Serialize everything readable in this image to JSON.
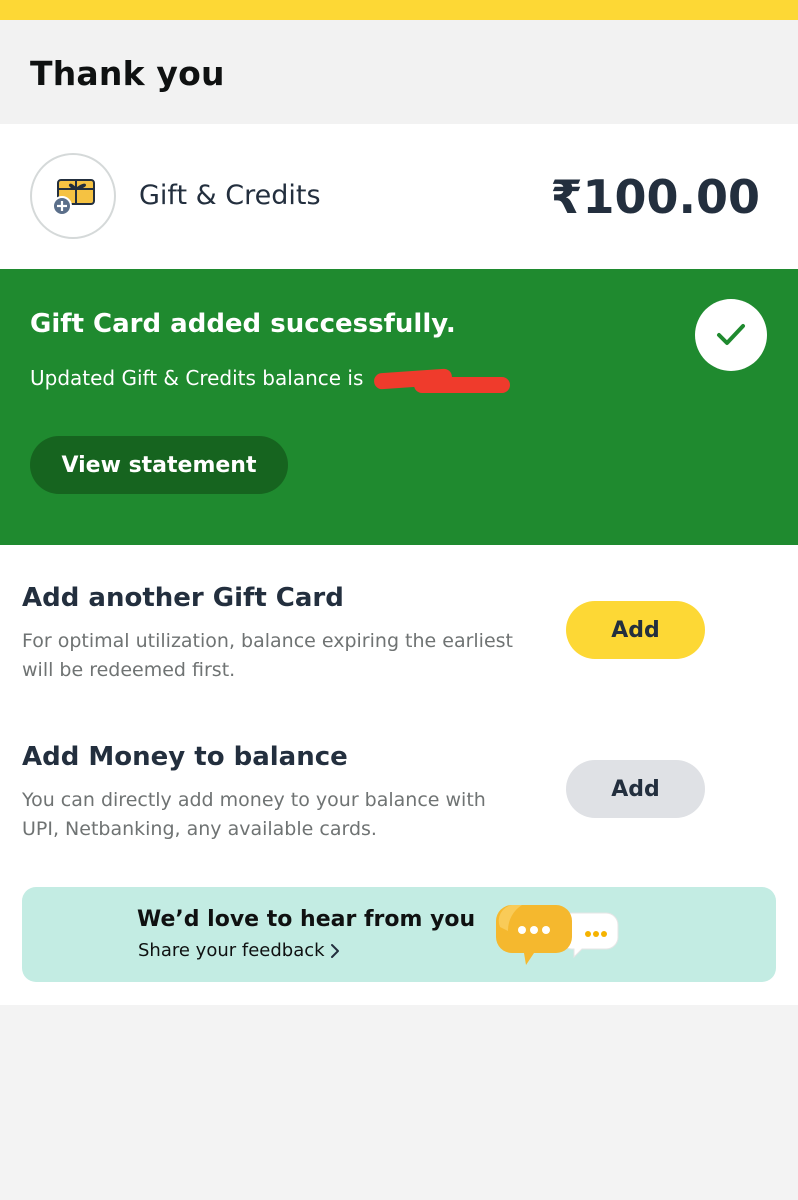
{
  "header": {
    "title": "Thank you"
  },
  "summary": {
    "icon": "gift-card-add-icon",
    "label": "Gift & Credits",
    "amount": "₹100.00"
  },
  "success": {
    "headline": "Gift Card added successfully.",
    "balance_prefix": "Updated Gift & Credits balance is",
    "view_statement_label": "View statement",
    "icon": "check-icon",
    "accent": "#1f8a2f"
  },
  "add_gift_card": {
    "title": "Add another Gift Card",
    "description": "For optimal utilization, balance expiring the earliest will be redeemed first.",
    "button_label": "Add"
  },
  "add_money": {
    "title": "Add Money to balance",
    "description": "You can directly add money to your balance with UPI, Netbanking, any available cards.",
    "button_label": "Add"
  },
  "feedback": {
    "title": "We’d love to hear from you",
    "subtitle": "Share your feedback",
    "icon": "chat-bubbles-icon"
  }
}
